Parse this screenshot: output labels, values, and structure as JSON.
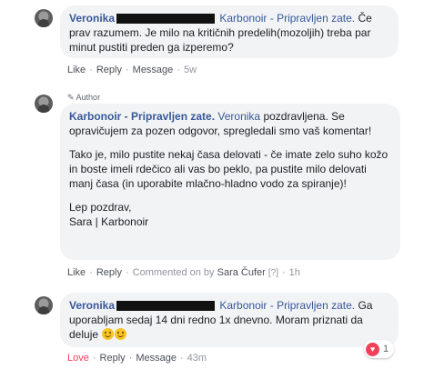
{
  "comments": [
    {
      "author": "Veronika",
      "page": "Karbonoir - Pripravljen zate.",
      "text": "Če prav razumem. Je milo na kritičnih predelih(mozoljih) treba par minut pustiti preden ga izperemo?",
      "actions": {
        "like": "Like",
        "reply": "Reply",
        "message": "Message",
        "time": "5w"
      }
    },
    {
      "badge": "Author",
      "author": "Karbonoir - Pripravljen zate.",
      "mention": "Veronika",
      "text1": "pozdravljena. Se opravičujem za pozen odgovor, spregledali smo vaš komentar!",
      "text2": "Tako je, milo pustite nekaj časa delovati - če imate zelo suho kožo in boste imeli rdečico ali vas bo peklo, pa pustite milo delovati manj časa (in uporabite mlačno-hladno vodo za spiranje)!",
      "text3a": "Lep pozdrav,",
      "text3b": "Sara | Karbonoir",
      "actions": {
        "like": "Like",
        "reply": "Reply",
        "commented_on_by": "Commented on by",
        "commenter": "Sara Čufer",
        "help": "[?]",
        "time": "1h"
      }
    },
    {
      "author": "Veronika",
      "page": "Karbonoir - Pripravljen zate.",
      "text": "Ga uporabljam sedaj 14 dni redno 1x dnevno. Moram priznati da deluje",
      "actions": {
        "love": "Love",
        "reply": "Reply",
        "message": "Message",
        "time": "43m"
      },
      "reaction_count": "1"
    }
  ],
  "icons": [
    "avatar",
    "pencil-icon",
    "smile-emoji",
    "heart-icon"
  ],
  "colors": {
    "link": "#385898",
    "bubble": "#f2f3f5",
    "love": "#f33e58",
    "meta": "#90949c"
  }
}
